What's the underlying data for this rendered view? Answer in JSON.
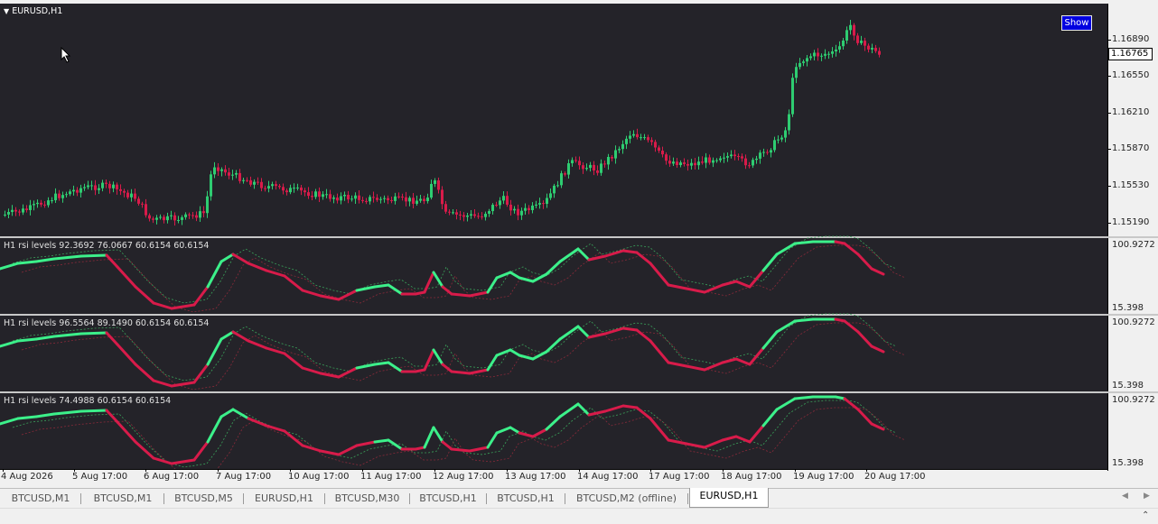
{
  "main": {
    "symbol_label": "EURUSD,H1",
    "show_button": "Show",
    "current_price": "1.16765",
    "price_levels": [
      "1.16890",
      "1.16550",
      "1.16210",
      "1.15870",
      "1.15530",
      "1.15190"
    ]
  },
  "indicators": [
    {
      "label": "H1  rsi levels  92.3692 76.0667 60.6154 60.6154",
      "top": "100.9272",
      "bottom": "15.398"
    },
    {
      "label": "H1  rsi levels  96.5564 89.1490 60.6154 60.6154",
      "top": "100.9272",
      "bottom": "15.398"
    },
    {
      "label": "H1  rsi levels  74.4988 60.6154 60.6154",
      "top": "100.9272",
      "bottom": "15.398"
    }
  ],
  "time_axis": [
    "4 Aug 2026",
    "5 Aug 17:00",
    "6 Aug 17:00",
    "7 Aug 17:00",
    "10 Aug 17:00",
    "11 Aug 17:00",
    "12 Aug 17:00",
    "13 Aug 17:00",
    "14 Aug 17:00",
    "17 Aug 17:00",
    "18 Aug 17:00",
    "19 Aug 17:00",
    "20 Aug 17:00"
  ],
  "tabs": [
    "BTCUSD,M1",
    "BTCUSD,M1",
    "BTCUSD,M5",
    "EURUSD,H1",
    "BTCUSD,M30",
    "BTCUSD,H1",
    "BTCUSD,H1",
    "BTCUSD,M2 (offline)",
    "EURUSD,H1"
  ],
  "active_tab": "EURUSD,H1",
  "colors": {
    "background": "#242329",
    "bull_candle": "#2ecc71",
    "bear_candle": "#d81b4a",
    "rsi_up": "#3cf08a",
    "rsi_down": "#d81b4a",
    "show_button": "#0000e0"
  }
}
